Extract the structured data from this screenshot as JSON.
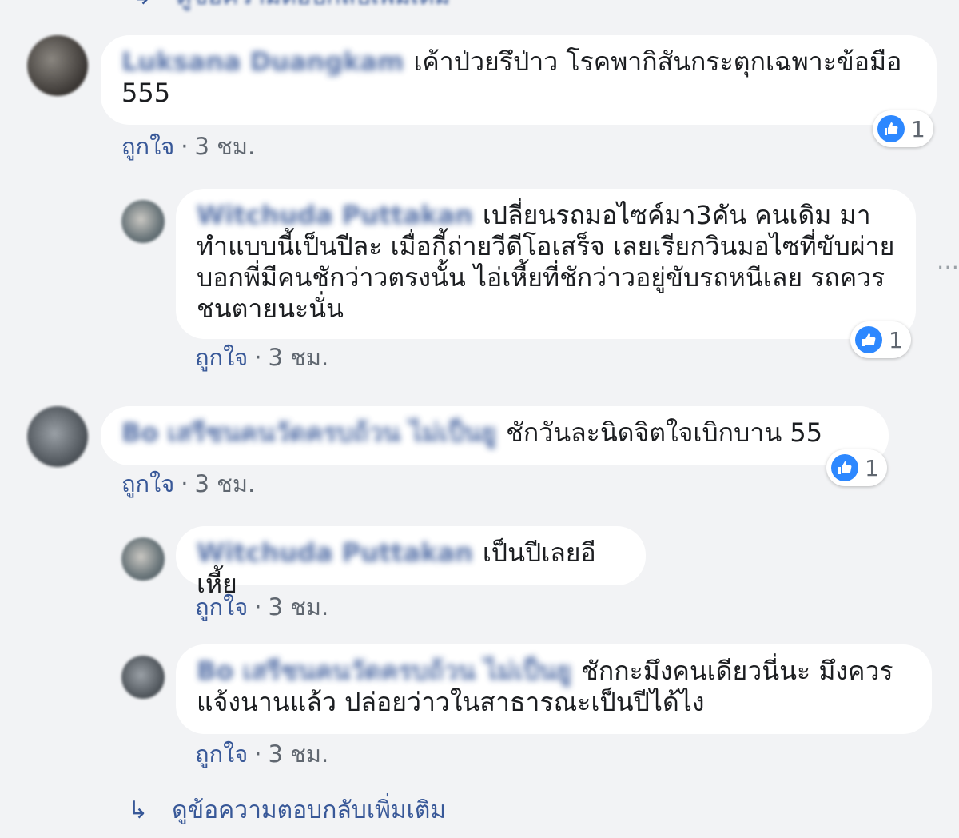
{
  "top_link": {
    "label": "ดูข้อความตอบกลับเพิ่มเติม"
  },
  "comments": [
    {
      "name": "Luksana Duangkam",
      "text": "เค้าป่วยรึป่าว โรคพากิสันกระตุกเฉพาะข้อมือ 555",
      "like_label": "ถูกใจ",
      "separator": "·",
      "time": "3 ชม.",
      "reaction_count": "1"
    },
    {
      "name": "Witchuda Puttakan",
      "text": "เปลี่ยนรถมอไซค์มา3คัน คนเดิม มาทำแบบนี้เป็นปีละ เมื่อกี้ถ่ายวีดีโอเสร็จ เลยเรียกวินมอไซที่ขับผ่าย บอกพี่มีคนชักว่าวตรงนั้น ไอ่เหี้ยที่ชักว่าวอยู่ขับรถหนีเลย รถควรชนตายนะนั่น",
      "like_label": "ถูกใจ",
      "separator": "·",
      "time": "3 ชม.",
      "reaction_count": "1"
    },
    {
      "name": "Bo เสรีชนคนวัดครบถ้วน ไม่เป็นยู",
      "text": "ชักวันละนิดจิตใจเบิกบาน 55",
      "like_label": "ถูกใจ",
      "separator": "·",
      "time": "3 ชม.",
      "reaction_count": "1"
    },
    {
      "name": "Witchuda Puttakan",
      "text": "เป็นปีเลยอีเหี้ย",
      "like_label": "ถูกใจ",
      "separator": "·",
      "time": "3 ชม."
    },
    {
      "name": "Bo เสรีชนคนวัดครบถ้วน ไม่เป็นยู",
      "text": "ชักกะมึงคนเดียวนี่นะ มึงควรแจ้งนานแล้ว ปล่อยว่าวในสาธารณะเป็นปีได้ไง",
      "like_label": "ถูกใจ",
      "separator": "·",
      "time": "3 ชม."
    }
  ],
  "more_replies": {
    "label": "ดูข้อความตอบกลับเพิ่มเติม",
    "icon": "reply-arrow-icon"
  },
  "colors": {
    "link": "#385898",
    "like": "#2d88ff",
    "bubble": "#ffffff",
    "background": "#f2f3f5"
  }
}
